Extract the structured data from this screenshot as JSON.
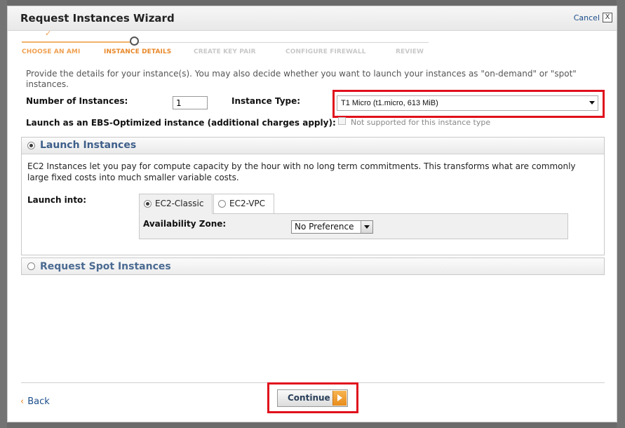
{
  "modal": {
    "title": "Request Instances Wizard",
    "cancel_label": "Cancel",
    "close_symbol": "X"
  },
  "steps": [
    {
      "label": "CHOOSE AN AMI",
      "state": "done"
    },
    {
      "label": "INSTANCE DETAILS",
      "state": "active"
    },
    {
      "label": "CREATE KEY PAIR",
      "state": "todo"
    },
    {
      "label": "CONFIGURE FIREWALL",
      "state": "todo"
    },
    {
      "label": "REVIEW",
      "state": "todo"
    }
  ],
  "intro": "Provide the details for your instance(s). You may also decide whether you want to launch your instances as \"on-demand\" or \"spot\" instances.",
  "number_of_instances": {
    "label": "Number of Instances:",
    "value": "1"
  },
  "instance_type": {
    "label": "Instance Type:",
    "value": "T1 Micro (t1.micro, 613 MiB)"
  },
  "ebs": {
    "label": "Launch as an EBS-Optimized instance (additional charges apply):",
    "note": "Not supported for this instance type",
    "checked": false
  },
  "launch_panel": {
    "title": "Launch Instances",
    "selected": true,
    "description": "EC2 Instances let you pay for compute capacity by the hour with no long term commitments. This transforms what are commonly large fixed costs into much smaller variable costs.",
    "launch_into_label": "Launch into:",
    "tabs": [
      {
        "label": "EC2-Classic",
        "selected": true
      },
      {
        "label": "EC2-VPC",
        "selected": false
      }
    ],
    "availability_zone": {
      "label": "Availability Zone:",
      "value": "No Preference"
    }
  },
  "spot_panel": {
    "title": "Request Spot Instances",
    "selected": false
  },
  "footer": {
    "back_label": "Back",
    "back_symbol": "‹",
    "continue_label": "Continue"
  },
  "colors": {
    "highlight": "#e0101c",
    "accent_orange": "#e8882a",
    "link": "#1a4e8a",
    "panel_title": "#3e5f8a"
  }
}
